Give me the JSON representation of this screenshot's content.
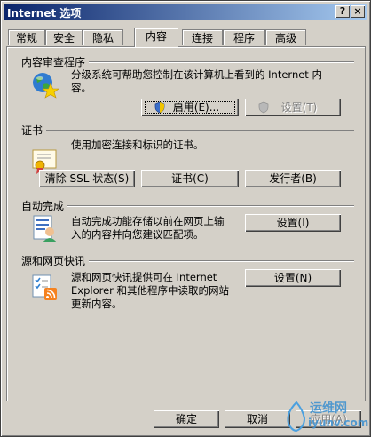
{
  "window": {
    "title": "Internet 选项",
    "help_label": "?",
    "close_label": "×"
  },
  "tabs": [
    {
      "label": "常规",
      "active": false
    },
    {
      "label": "安全",
      "active": false
    },
    {
      "label": "隐私",
      "active": false
    },
    {
      "label": "内容",
      "active": true
    },
    {
      "label": "连接",
      "active": false
    },
    {
      "label": "程序",
      "active": false
    },
    {
      "label": "高级",
      "active": false
    }
  ],
  "content_advisor": {
    "title": "内容审查程序",
    "description_line1": "分级系统可帮助您控制在该计算机上看到的 Internet 内",
    "description_line2": "容。",
    "enable_label": "启用(E)...",
    "settings_label": "设置(T)"
  },
  "certificates": {
    "title": "证书",
    "description": "使用加密连接和标识的证书。",
    "clear_ssl_label": "清除 SSL 状态(S)",
    "certificates_label": "证书(C)",
    "publishers_label": "发行者(B)"
  },
  "autocomplete": {
    "title": "自动完成",
    "description_line1": "自动完成功能存储以前在网页上输",
    "description_line2": "入的内容并向您建议匹配项。",
    "settings_label": "设置(I)"
  },
  "feeds": {
    "title": "源和网页快讯",
    "description_line1": "源和网页快讯提供可在 Internet",
    "description_line2": "Explorer 和其他程序中读取的网站",
    "description_line3": "更新内容。",
    "settings_label": "设置(N)"
  },
  "footer": {
    "ok_label": "确定",
    "cancel_label": "取消",
    "apply_label": "应用(A)"
  },
  "watermark": {
    "text1": "运维网",
    "text2": "iyunv.com"
  },
  "colors": {
    "title_start": "#0a246a",
    "title_end": "#a6caf0",
    "face": "#d4d0c8"
  }
}
